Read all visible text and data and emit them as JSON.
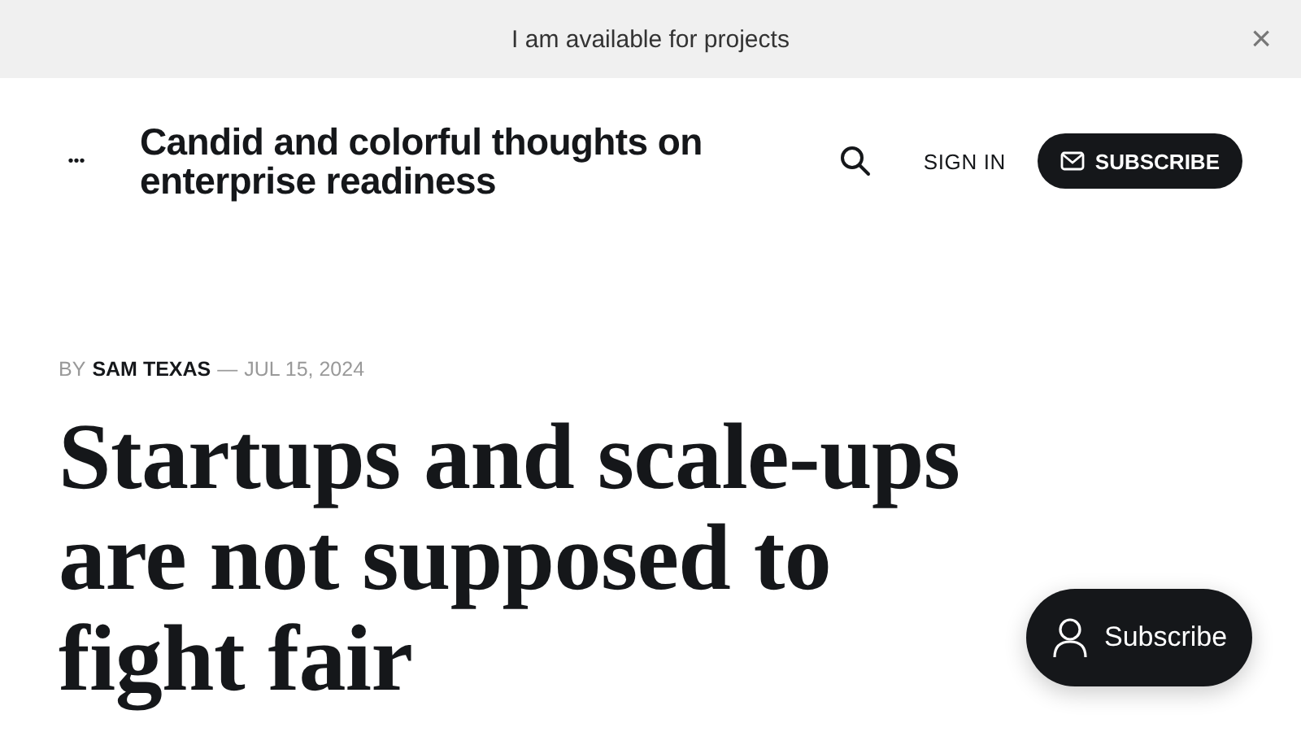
{
  "announcement_bar": {
    "text": "I am available for projects",
    "close": "×"
  },
  "header": {
    "menu": "•••",
    "site_title": "Candid and colorful thoughts on enterprise readiness",
    "sign_in": "SIGN IN",
    "subscribe": "SUBSCRIBE"
  },
  "article": {
    "by_label": "BY",
    "author": "SAM TEXAS",
    "separator": "—",
    "date": "JUL 15, 2024",
    "title": "Startups and scale-ups are not supposed to fight fair"
  },
  "floating_button": {
    "label": "Subscribe"
  }
}
